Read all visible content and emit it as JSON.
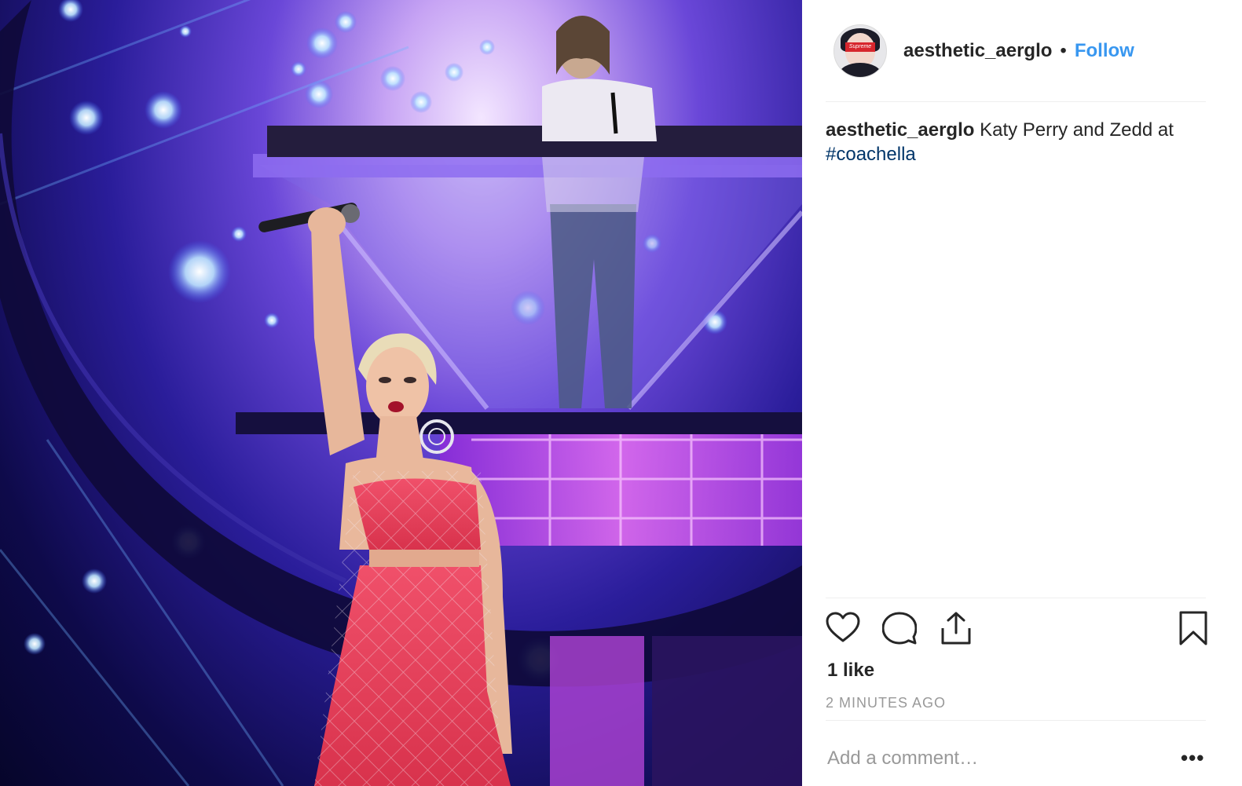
{
  "post": {
    "username": "aesthetic_aerglo",
    "dot": "•",
    "follow_label": "Follow",
    "caption": {
      "username": "aesthetic_aerglo",
      "text": " Katy Perry and Zedd at ",
      "hashtag": "#coachella"
    },
    "likes": "1 like",
    "time": "2 MINUTES AGO",
    "comment_placeholder": "Add a comment…",
    "more_label": "•••"
  },
  "avatar": {
    "badge_text": "Supreme"
  },
  "icons": {
    "like": "heart-icon",
    "comment": "comment-bubble-icon",
    "share": "share-icon",
    "save": "bookmark-icon",
    "more": "more-options-icon"
  },
  "colors": {
    "link": "#3897f0",
    "hashtag": "#003569",
    "muted": "#999999",
    "divider": "#efefef"
  }
}
